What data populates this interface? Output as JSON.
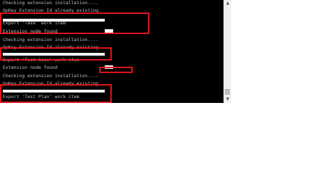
{
  "console": {
    "lines": [
      "Checking extension installation....",
      "OpKey Extension Id already existing.",
      "Export 'Task' work item",
      "Extension node found",
      "Checking extension installation....",
      "OpKey Extension Id already existing.",
      "Export 'Test Case' work item",
      "Extension node found",
      "Checking extension installation....",
      "OpKey Extension Id already existing.",
      "Export 'Test Plan' work item"
    ],
    "colors": {
      "background": "#000000",
      "text": "#c0c0c0",
      "highlight": "#e3141c"
    }
  },
  "scrollbar": {
    "up_icon": "scroll-up-arrow-icon",
    "down_icon": "scroll-down-arrow-icon",
    "up_glyph": "▲",
    "down_glyph": "▼"
  }
}
